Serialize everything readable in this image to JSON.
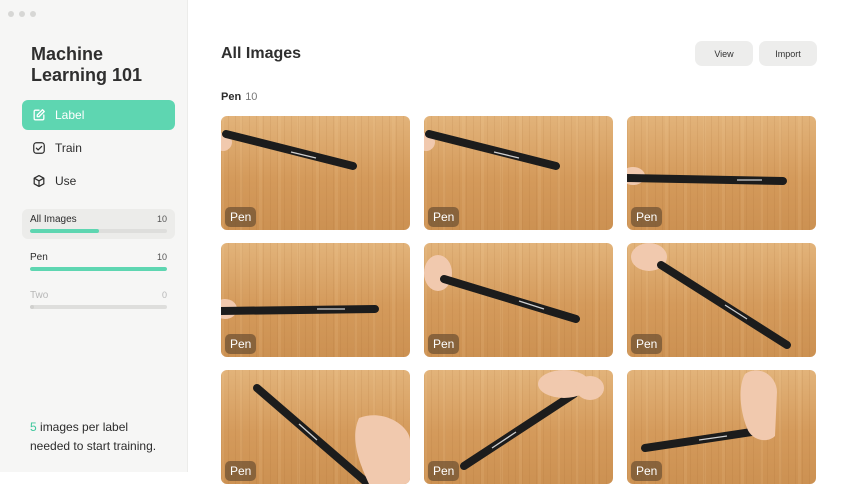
{
  "app": {
    "title": "Machine Learning 101"
  },
  "nav": [
    {
      "label": "Label",
      "icon": "edit-icon",
      "active": true
    },
    {
      "label": "Train",
      "icon": "checkbox-icon",
      "active": false
    },
    {
      "label": "Use",
      "icon": "cube-icon",
      "active": false
    }
  ],
  "labels": [
    {
      "name": "All Images",
      "count": "10",
      "progress": 0.5,
      "selected": true
    },
    {
      "name": "Pen",
      "count": "10",
      "progress": 1.0,
      "selected": false
    },
    {
      "name": "Two",
      "count": "0",
      "progress": 0.0,
      "selected": false
    }
  ],
  "hint": {
    "number": "5",
    "text_before": " images per label",
    "text_after": "needed to start training."
  },
  "main": {
    "title": "All Images",
    "view_button": "View",
    "import_button": "Import",
    "section": {
      "name": "Pen",
      "count": "10"
    }
  },
  "images": [
    {
      "label": "Pen"
    },
    {
      "label": "Pen"
    },
    {
      "label": "Pen"
    },
    {
      "label": "Pen"
    },
    {
      "label": "Pen"
    },
    {
      "label": "Pen"
    },
    {
      "label": "Pen"
    },
    {
      "label": "Pen"
    },
    {
      "label": "Pen"
    }
  ],
  "colors": {
    "accent": "#5ed6b1",
    "accent_text": "#3ec79c",
    "sidebar_bg": "#f6f6f5",
    "button_bg": "#ededec"
  }
}
